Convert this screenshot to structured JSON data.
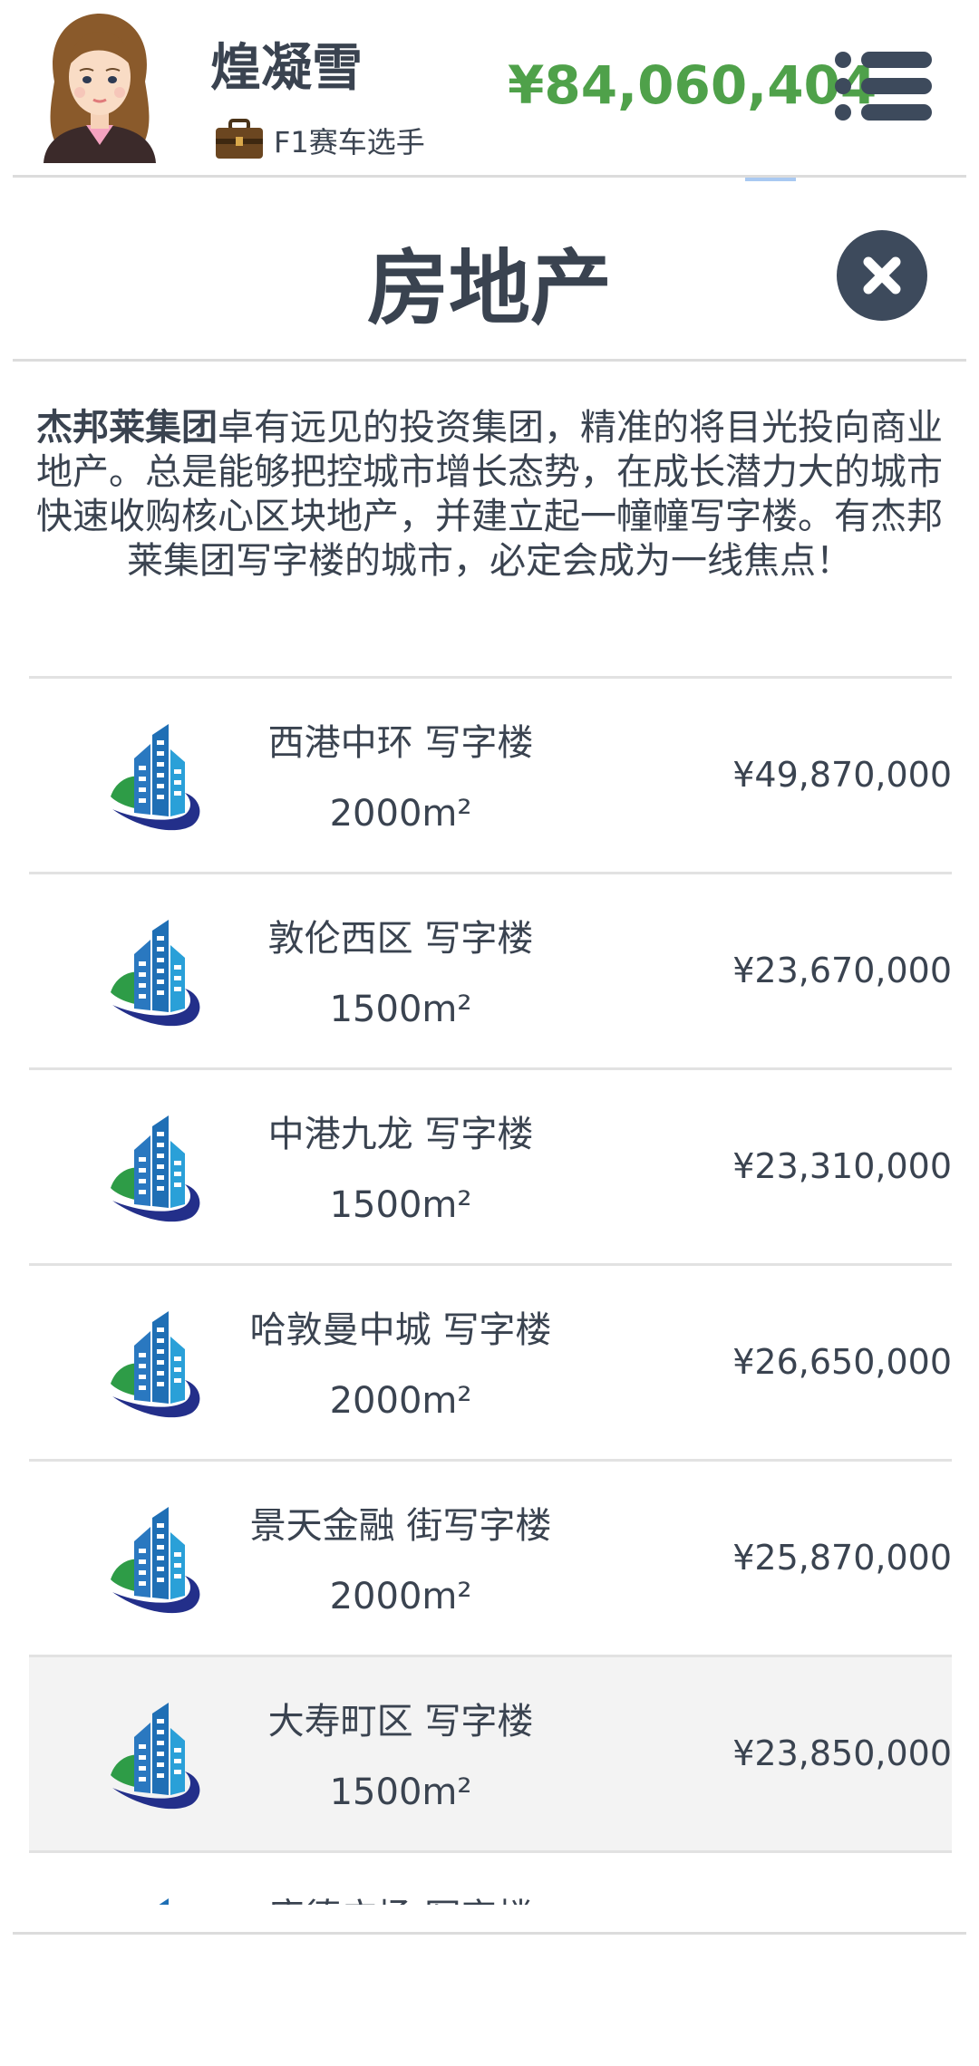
{
  "header": {
    "player_name": "煌凝雪",
    "job_icon": "briefcase-icon",
    "job_title": "F1赛车选手",
    "money": "¥84,060,404",
    "menu_icon": "menu-list-icon"
  },
  "section": {
    "title": "房地产",
    "close_icon": "close-icon"
  },
  "description": {
    "company": "杰邦莱集团",
    "text": "卓有远见的投资集团，精准的将目光投向商业地产。总是能够把控城市增长态势，在成长潜力大的城市快速收购核心区块地产，并建立起一幢幢写字楼。有杰邦莱集团写字楼的城市，必定会成为一线焦点！"
  },
  "properties": [
    {
      "name": "西港中环 写字楼",
      "area": "2000m²",
      "price": "¥49,870,000",
      "icon": "office-building-icon"
    },
    {
      "name": "敦伦西区 写字楼",
      "area": "1500m²",
      "price": "¥23,670,000",
      "icon": "office-building-icon"
    },
    {
      "name": "中港九龙 写字楼",
      "area": "1500m²",
      "price": "¥23,310,000",
      "icon": "office-building-icon"
    },
    {
      "name": "哈敦曼中城 写字楼",
      "area": "2000m²",
      "price": "¥26,650,000",
      "icon": "office-building-icon"
    },
    {
      "name": "景天金融 街写字楼",
      "area": "2000m²",
      "price": "¥25,870,000",
      "icon": "office-building-icon"
    },
    {
      "name": "大寿町区 写字楼",
      "area": "1500m²",
      "price": "¥23,850,000",
      "icon": "office-building-icon"
    },
    {
      "name": "唐德广场 写字楼",
      "area": "",
      "price": "",
      "icon": "office-building-icon"
    }
  ],
  "colors": {
    "money_green": "#4fa14a",
    "text_dark": "#3a4350",
    "close_button": "#3d4a5c",
    "selected_row": "#f3f3f3"
  }
}
